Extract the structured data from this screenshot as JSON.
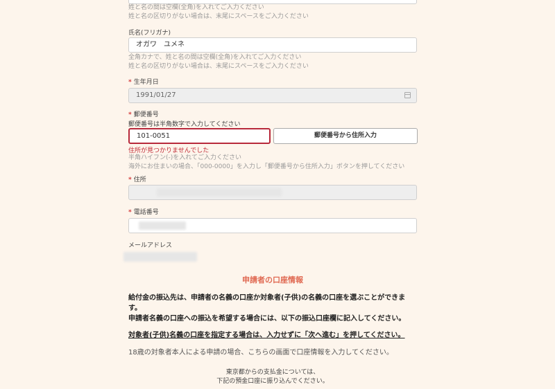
{
  "name_kanji": {
    "hint1": "姓と名の間は空欄(全角)を入れてご入力ください",
    "hint2": "姓と名の区切りがない場合は、末尾にスペースをご入力ください"
  },
  "name_kana": {
    "label": "氏名(フリガナ)",
    "value": "オガワ　ユメネ",
    "hint1": "全角カナで、姓と名の間は空欄(全角)を入れてご入力ください",
    "hint2": "姓と名の区切りがない場合は、末尾にスペースをご入力ください"
  },
  "birth": {
    "required_mark": "*",
    "label": "生年月日",
    "value": "1991/01/27",
    "icon": "calendar-icon"
  },
  "postal": {
    "required_mark": "*",
    "label": "郵便番号",
    "sub": "郵便番号は半角数字で入力してください",
    "value": "101-0051",
    "button": "郵便番号から住所入力",
    "error": "住所が見つかりませんでした",
    "hint1": "半角ハイフン(-)を入れてご入力ください",
    "hint2": "海外にお住まいの場合、「000-0000」を入力し「郵便番号から住所入力」ボタンを押してください"
  },
  "address": {
    "required_mark": "*",
    "label": "住所"
  },
  "phone": {
    "required_mark": "*",
    "label": "電話番号"
  },
  "email": {
    "label": "メールアドレス"
  },
  "account": {
    "title": "申請者の口座情報",
    "p1": "給付金の振込先は、申請者の名義の口座か対象者(子供)の名義の口座を選ぶことができます。",
    "p2": "申請者名義の口座への振込を希望する場合には、以下の振込口座欄に記入してください。",
    "p3": "対象者(子供)名義の口座を指定する場合は、入力せずに「次へ進む」を押してください。",
    "p4": "18歳の対象者本人による申請の場合、こちらの画面で口座情報を入力してください。",
    "c1": "東京都からの支払金については、",
    "c2": "下記の預金口座に振り込んでください。"
  }
}
